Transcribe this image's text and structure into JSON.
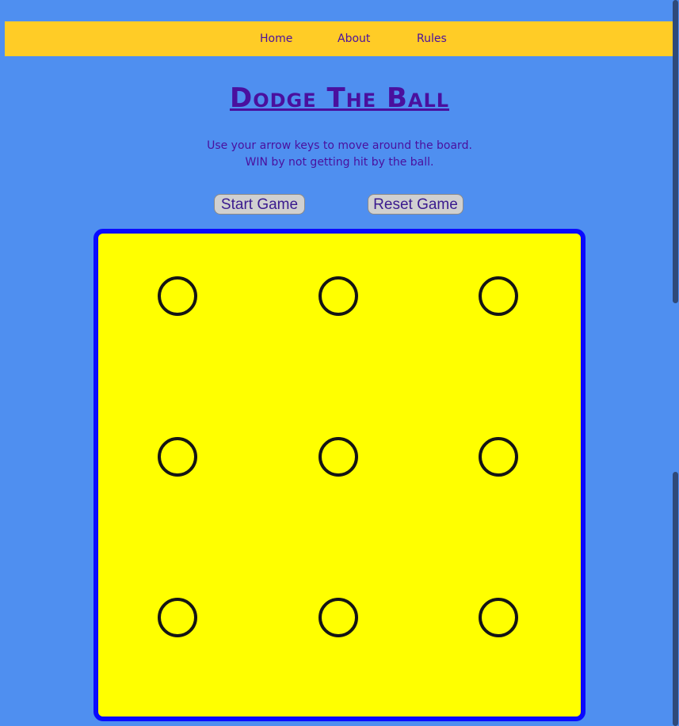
{
  "nav": {
    "items": [
      {
        "label": "Home"
      },
      {
        "label": "About"
      },
      {
        "label": "Rules"
      }
    ],
    "background": "#ffcc26"
  },
  "header": {
    "title": "Dodge The Ball",
    "instructions": [
      "Use your arrow keys to move around the board.",
      "WIN by not getting hit by the ball."
    ]
  },
  "controls": {
    "start_label": "Start Game",
    "reset_label": "Reset Game"
  },
  "board": {
    "rows": 3,
    "cols": 3,
    "cells": [
      "empty",
      "empty",
      "empty",
      "empty",
      "empty",
      "empty",
      "empty",
      "empty",
      "empty"
    ],
    "background": "#ffff00",
    "border_color": "#0a0aff"
  },
  "colors": {
    "page_background": "#4f8ff0",
    "text": "#4a109e"
  }
}
